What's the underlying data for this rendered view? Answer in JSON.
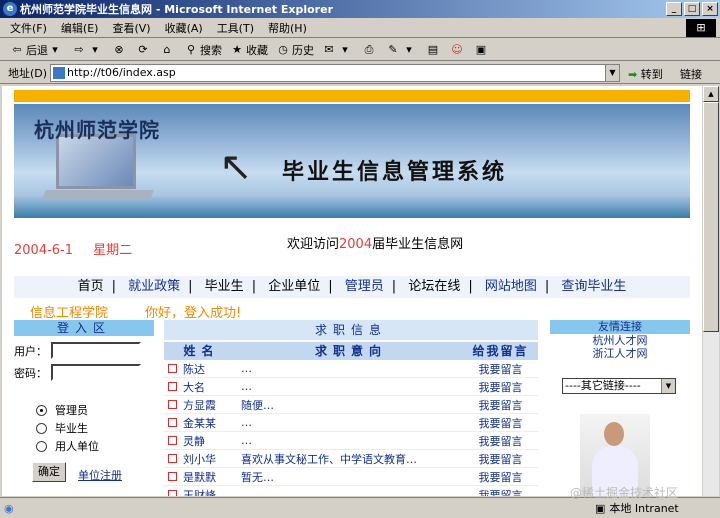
{
  "window": {
    "title": "杭州师范学院毕业生信息网 - Microsoft Internet Explorer",
    "minimize": "_",
    "maximize": "□",
    "close": "×"
  },
  "menu": [
    "文件(F)",
    "编辑(E)",
    "查看(V)",
    "收藏(A)",
    "工具(T)",
    "帮助(H)"
  ],
  "toolbar": {
    "back": "后退",
    "search": "搜索",
    "favorites": "收藏",
    "history": "历史"
  },
  "address": {
    "label": "地址(D)",
    "url": "http://t06/index.asp",
    "go": "转到",
    "links": "链接"
  },
  "status": {
    "zone": "本地 Intranet"
  },
  "watermark": "@稀土掘金技术社区",
  "banner": {
    "school": "杭州师范学院",
    "system": "毕业生信息管理系统"
  },
  "date": {
    "day": "2004-6-1",
    "weekday": "星期二"
  },
  "welcome": {
    "prefix": "欢迎访问",
    "year": "2004",
    "suffix": "届毕业生信息网"
  },
  "nav": [
    "首页",
    "就业政策",
    "毕业生",
    "企业单位",
    "管理员",
    "论坛在线",
    "网站地图",
    "查询毕业生"
  ],
  "user": {
    "college": "信息工程学院",
    "greeting": "你好，登入成功!"
  },
  "login": {
    "title": "登入区",
    "user_label": "用户：",
    "pass_label": "密码：",
    "options": [
      "管理员",
      "毕业生",
      "用人单位"
    ],
    "selected": 0,
    "submit": "确定",
    "register": "单位注册"
  },
  "jobs": {
    "title": "求职信息",
    "col_name": "姓名",
    "col_intent": "求职意向",
    "col_msg": "给我留言",
    "rows": [
      {
        "name": "陈达",
        "intent": "…",
        "msg": "我要留言"
      },
      {
        "name": "大名",
        "intent": "…",
        "msg": "我要留言"
      },
      {
        "name": "方显霞",
        "intent": "随便…",
        "msg": "我要留言"
      },
      {
        "name": "金某某",
        "intent": "…",
        "msg": "我要留言"
      },
      {
        "name": "灵静",
        "intent": "…",
        "msg": "我要留言"
      },
      {
        "name": "刘小华",
        "intent": "喜欢从事文秘工作、中学语文教育…",
        "msg": "我要留言"
      },
      {
        "name": "是默默",
        "intent": "暂无…",
        "msg": "我要留言"
      },
      {
        "name": "王财峰",
        "intent": "…",
        "msg": "我要留言"
      }
    ]
  },
  "links": {
    "title": "友情连接",
    "items": [
      "杭州人才网",
      "浙江人才网"
    ],
    "other": "----其它链接----"
  }
}
